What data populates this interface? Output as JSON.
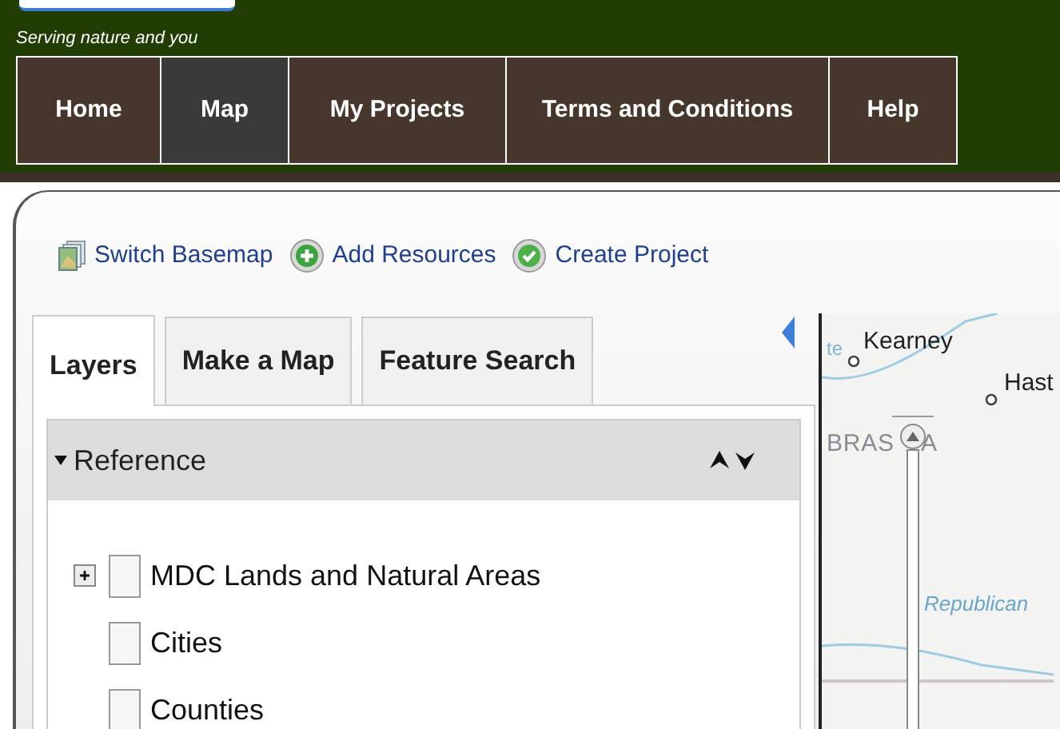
{
  "header": {
    "tagline": "Serving nature and you"
  },
  "nav": [
    {
      "label": "Home",
      "selected": false
    },
    {
      "label": "Map",
      "selected": true
    },
    {
      "label": "My Projects",
      "selected": false
    },
    {
      "label": "Terms and Conditions",
      "selected": false
    },
    {
      "label": "Help",
      "selected": false
    }
  ],
  "toolbar": [
    {
      "label": "Switch Basemap",
      "kind": "basemap"
    },
    {
      "label": "Add Resources",
      "kind": "add"
    },
    {
      "label": "Create Project",
      "kind": "check"
    }
  ],
  "tabs": [
    {
      "label": "Layers",
      "selected": true
    },
    {
      "label": "Make a Map",
      "selected": false
    },
    {
      "label": "Feature Search",
      "selected": false
    }
  ],
  "section": {
    "title": "Reference",
    "expanded": true
  },
  "layers": [
    {
      "label": "MDC Lands and Natural Areas",
      "checked": false,
      "expandable": true
    },
    {
      "label": "Cities",
      "checked": false,
      "expandable": false
    },
    {
      "label": "Counties",
      "checked": false,
      "expandable": false
    }
  ],
  "map": {
    "zoom": {
      "level": 1
    },
    "labels": [
      {
        "text": "te",
        "kind": "faint"
      },
      {
        "text": "Kearney",
        "kind": "city"
      },
      {
        "text": "Hast",
        "kind": "city"
      },
      {
        "text": "BRAS",
        "kind": "state"
      },
      {
        "text": "A",
        "kind": "state"
      },
      {
        "text": "Republican",
        "kind": "river"
      }
    ]
  }
}
